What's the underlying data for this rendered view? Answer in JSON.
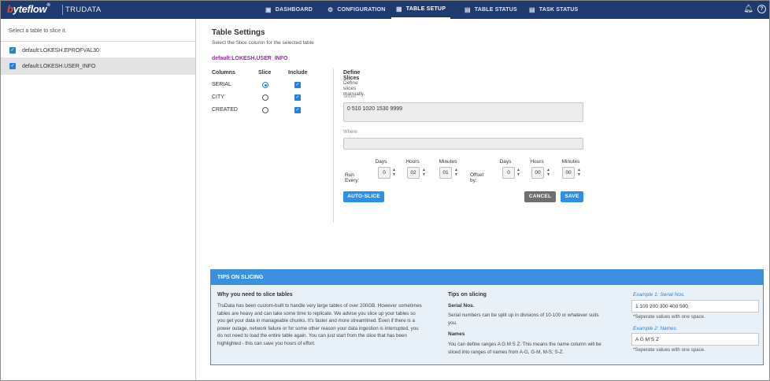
{
  "app": {
    "logo_text": "byteflow",
    "logo_trademark": "®",
    "product": "TRUDATA",
    "nav": [
      {
        "label": "DASHBOARD",
        "icon": "dashboard-icon"
      },
      {
        "label": "CONFIGURATION",
        "icon": "gear-icon"
      },
      {
        "label": "TABLE SETUP",
        "icon": "table-icon"
      },
      {
        "label": "TABLE STATUS",
        "icon": "calendar-icon"
      },
      {
        "label": "TASK STATUS",
        "icon": "calendar-icon"
      }
    ],
    "active_nav": "TABLE SETUP"
  },
  "sidebar": {
    "hint": "Select a table to slice it.",
    "tables": [
      {
        "label": "default:LOKESH.EPROFVAL30",
        "checked": true
      },
      {
        "label": "default:LOKESH.USER_INFO",
        "checked": true
      }
    ]
  },
  "settings": {
    "title": "Table Settings",
    "subtitle": "Select the Slice column for the selected table",
    "table_name": "default:LOKESH.USER_INFO",
    "col_header": "Columns",
    "slice_header": "Slice",
    "include_header": "Include",
    "columns": [
      {
        "name": "SERIAL",
        "slice": true,
        "include": true
      },
      {
        "name": "CITY",
        "slice": false,
        "include": true
      },
      {
        "name": "CREATED",
        "slice": false,
        "include": true
      }
    ]
  },
  "define": {
    "title": "Define Slices",
    "subtitle": "Define slices manually.",
    "slices_label": "Slices",
    "slices_value": "0 510 1020 1530 9999",
    "where_label": "Where",
    "where_value": "",
    "run_every_label": "Run Every:",
    "offset_by_label": "Offset by:",
    "days_label": "Days",
    "hours_label": "Hours",
    "minutes_label": "Minutes",
    "run_days": "0",
    "run_hours": "02",
    "run_minutes": "01",
    "off_days": "0",
    "off_hours": "00",
    "off_minutes": "00",
    "auto_slice": "AUTO-SLICE",
    "cancel": "CANCEL",
    "save": "SAVE"
  },
  "tips": {
    "header": "TIPS ON SLICING",
    "why_title": "Why you need to slice tables",
    "why_line1": "TruData has been custom-built to handle very large tables of over 200GB. However sometimes",
    "why_line2": "tables are heavy and can take some time to replicate. We advise you slice up your tables so",
    "why_line3": "you get your data in manageable chunks. It's faster and more streamlined. Even if there is a",
    "why_line4": "power outage, network failure or for some other reason your data ingestion is interrupted, you",
    "why_line5": "do not need to load the entire table again. You can just start from the slice that has been",
    "why_line6": "highlighted - this can save you hours of effort.",
    "tips_title": "Tips on slicing",
    "serial_title": "Serial Nos.",
    "serial_line1": "Serial numbers can be split up in divisions of 10-100 or whatever suits",
    "serial_line2": "you.",
    "names_title": "Names",
    "names_line1": "You can define ranges A G M S Z. This means the name column will be",
    "names_line2": "sliced into ranges of names from A-G, G-M, M-S, S-Z.",
    "ex1_label": "Example 1: Serial Nos.",
    "ex1_value": "1 100 200 300 400 500",
    "ex1_note": "*Seperate values with one space.",
    "ex2_label": "Example 2: Names",
    "ex2_value": "A G M S Z",
    "ex2_note": "*Seperate values with one space."
  }
}
